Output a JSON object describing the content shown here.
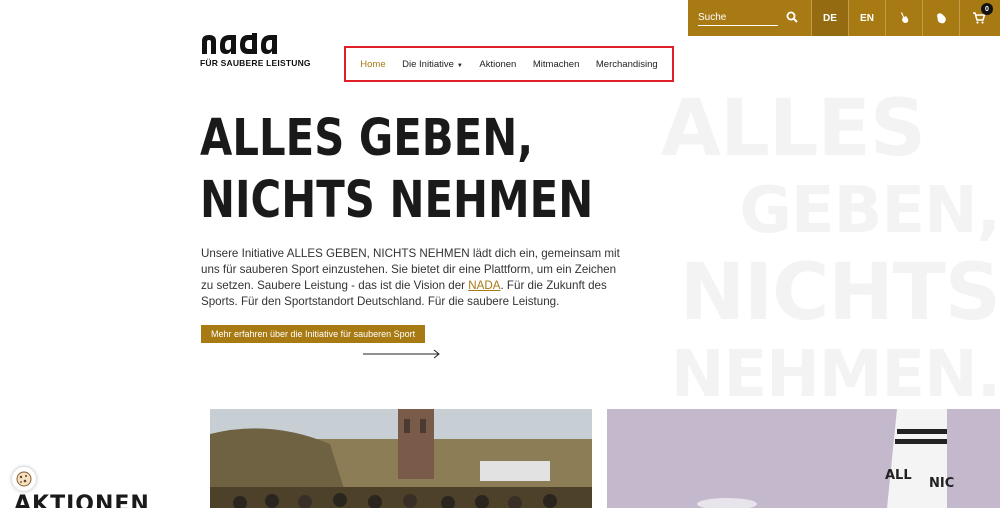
{
  "topbar": {
    "search_placeholder": "Suche",
    "lang_de": "DE",
    "lang_en": "EN",
    "cart_count": "0"
  },
  "logo": {
    "subtitle": "FÜR SAUBERE LEISTUNG"
  },
  "nav": {
    "items": [
      {
        "label": "Home"
      },
      {
        "label": "Die Initiative"
      },
      {
        "label": "Aktionen"
      },
      {
        "label": "Mitmachen"
      },
      {
        "label": "Merchandising"
      }
    ]
  },
  "hero": {
    "headline_line1": "ALLES GEBEN,",
    "headline_line2": "NICHTS NEHMEN",
    "bg_line1": "ALLES",
    "bg_line2": "GEBEN,",
    "bg_line3": "NICHTS",
    "bg_line4": "NEHMEN.",
    "intro_part1": "Unsere Initiative ALLES GEBEN, NICHTS NEHMEN lädt dich ein, gemeinsam mit uns für sauberen Sport einzustehen. Sie bietet dir eine Plattform, um ein Zeichen zu setzen. Saubere Leistung - das ist die Vision der ",
    "intro_link": "NADA",
    "intro_part2": ". Für die Zukunft des Sports. Für den Sportstandort Deutschland. Für die saubere Leistung.",
    "cta_label": "Mehr erfahren über die Initiative für sauberen Sport"
  },
  "promo": {
    "sock_text": "ALLES GEBEN NICHTS"
  },
  "sections": {
    "aktionen_title": "AKTIONEN"
  },
  "colors": {
    "accent": "#a87a14",
    "highlight_border": "#e01e28"
  }
}
